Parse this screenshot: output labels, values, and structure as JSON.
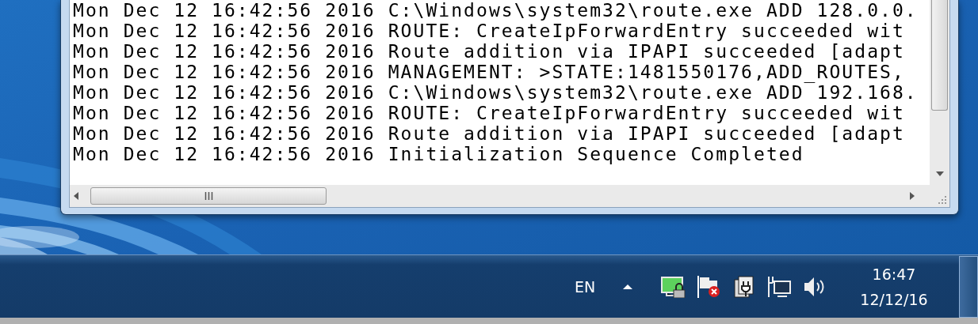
{
  "console": {
    "log_lines": [
      "Mon Dec 12 16:42:56 2016 C:\\Windows\\system32\\route.exe ADD 128.0.0.",
      "Mon Dec 12 16:42:56 2016 ROUTE: CreateIpForwardEntry succeeded wit",
      "Mon Dec 12 16:42:56 2016 Route addition via IPAPI succeeded [adapt",
      "Mon Dec 12 16:42:56 2016 MANAGEMENT: >STATE:1481550176,ADD_ROUTES,",
      "Mon Dec 12 16:42:56 2016 C:\\Windows\\system32\\route.exe ADD 192.168.",
      "Mon Dec 12 16:42:56 2016 ROUTE: CreateIpForwardEntry succeeded wit",
      "Mon Dec 12 16:42:56 2016 Route addition via IPAPI succeeded [adapt",
      "Mon Dec 12 16:42:56 2016 Initialization Sequence Completed"
    ]
  },
  "taskbar": {
    "language": "EN",
    "time": "16:47",
    "date": "12/12/16"
  }
}
